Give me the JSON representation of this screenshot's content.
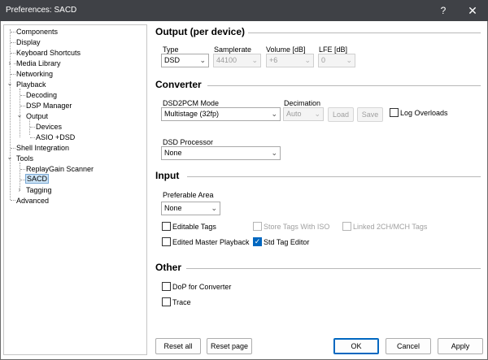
{
  "window": {
    "title": "Preferences: SACD",
    "help_glyph": "?",
    "close_glyph": "✕"
  },
  "tree": {
    "items": [
      {
        "label": "Components"
      },
      {
        "label": "Display"
      },
      {
        "label": "Keyboard Shortcuts"
      },
      {
        "label": "Media Library"
      },
      {
        "label": "Networking"
      },
      {
        "label": "Playback"
      },
      {
        "label": "Decoding"
      },
      {
        "label": "DSP Manager"
      },
      {
        "label": "Output"
      },
      {
        "label": "Devices"
      },
      {
        "label": "ASIO +DSD"
      },
      {
        "label": "Shell Integration"
      },
      {
        "label": "Tools"
      },
      {
        "label": "ReplayGain Scanner"
      },
      {
        "label": "SACD",
        "selected": true
      },
      {
        "label": "Tagging"
      },
      {
        "label": "Advanced"
      }
    ]
  },
  "output": {
    "heading": "Output (per device)",
    "type_label": "Type",
    "type_value": "DSD",
    "samplerate_label": "Samplerate",
    "samplerate_value": "44100",
    "volume_label": "Volume [dB]",
    "volume_value": "+6",
    "lfe_label": "LFE [dB]",
    "lfe_value": "0"
  },
  "converter": {
    "heading": "Converter",
    "mode_label": "DSD2PCM Mode",
    "mode_value": "Multistage (32fp)",
    "decimation_label": "Decimation",
    "decimation_value": "Auto",
    "load_label": "Load",
    "save_label": "Save",
    "log_overloads_label": "Log Overloads",
    "dsd_processor_label": "DSD Processor",
    "dsd_processor_value": "None"
  },
  "input": {
    "heading": "Input",
    "preferable_area_label": "Preferable Area",
    "preferable_area_value": "None",
    "editable_tags_label": "Editable Tags",
    "store_tags_label": "Store Tags With ISO",
    "linked_tags_label": "Linked 2CH/MCH Tags",
    "edited_master_label": "Edited Master Playback",
    "std_tag_editor_label": "Std Tag Editor"
  },
  "other": {
    "heading": "Other",
    "dop_label": "DoP for Converter",
    "trace_label": "Trace"
  },
  "footer": {
    "reset_all": "Reset all",
    "reset_page": "Reset page",
    "ok": "OK",
    "cancel": "Cancel",
    "apply": "Apply"
  },
  "glyphs": {
    "chevron_down": "⌄",
    "check": "✓",
    "expand": "›",
    "collapse": "⌄"
  }
}
